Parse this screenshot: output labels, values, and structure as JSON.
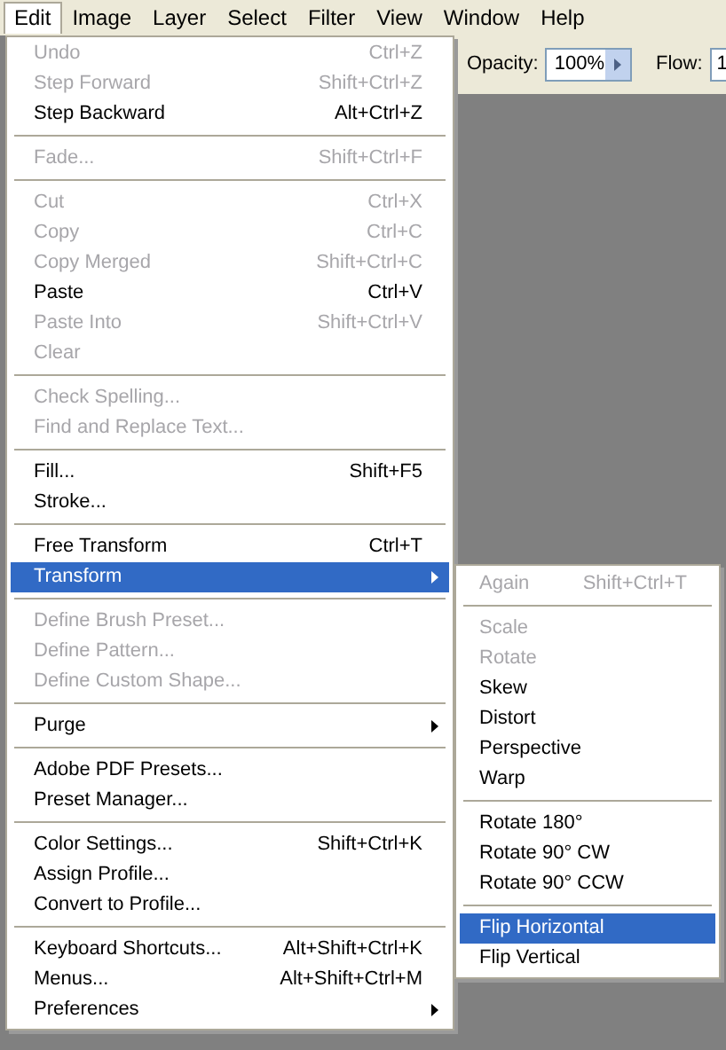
{
  "menu_bar": [
    {
      "label": "Edit",
      "selected": true
    },
    {
      "label": "Image",
      "selected": false
    },
    {
      "label": "Layer",
      "selected": false
    },
    {
      "label": "Select",
      "selected": false
    },
    {
      "label": "Filter",
      "selected": false
    },
    {
      "label": "View",
      "selected": false
    },
    {
      "label": "Window",
      "selected": false
    },
    {
      "label": "Help",
      "selected": false
    }
  ],
  "options_bar": {
    "opacity_label": "Opacity:",
    "opacity_value": "100%",
    "flow_label": "Flow:",
    "flow_value": "1"
  },
  "edit_menu": [
    [
      {
        "label": "Undo",
        "shortcut": "Ctrl+Z",
        "disabled": true,
        "selected": false,
        "submenu": false
      },
      {
        "label": "Step Forward",
        "shortcut": "Shift+Ctrl+Z",
        "disabled": true,
        "selected": false,
        "submenu": false
      },
      {
        "label": "Step Backward",
        "shortcut": "Alt+Ctrl+Z",
        "disabled": false,
        "selected": false,
        "submenu": false
      }
    ],
    [
      {
        "label": "Fade...",
        "shortcut": "Shift+Ctrl+F",
        "disabled": true,
        "selected": false,
        "submenu": false
      }
    ],
    [
      {
        "label": "Cut",
        "shortcut": "Ctrl+X",
        "disabled": true,
        "selected": false,
        "submenu": false
      },
      {
        "label": "Copy",
        "shortcut": "Ctrl+C",
        "disabled": true,
        "selected": false,
        "submenu": false
      },
      {
        "label": "Copy Merged",
        "shortcut": "Shift+Ctrl+C",
        "disabled": true,
        "selected": false,
        "submenu": false
      },
      {
        "label": "Paste",
        "shortcut": "Ctrl+V",
        "disabled": false,
        "selected": false,
        "submenu": false
      },
      {
        "label": "Paste Into",
        "shortcut": "Shift+Ctrl+V",
        "disabled": true,
        "selected": false,
        "submenu": false
      },
      {
        "label": "Clear",
        "disabled": true,
        "selected": false,
        "submenu": false
      }
    ],
    [
      {
        "label": "Check Spelling...",
        "disabled": true,
        "selected": false,
        "submenu": false
      },
      {
        "label": "Find and Replace Text...",
        "disabled": true,
        "selected": false,
        "submenu": false
      }
    ],
    [
      {
        "label": "Fill...",
        "shortcut": "Shift+F5",
        "disabled": false,
        "selected": false,
        "submenu": false
      },
      {
        "label": "Stroke...",
        "disabled": false,
        "selected": false,
        "submenu": false
      }
    ],
    [
      {
        "label": "Free Transform",
        "shortcut": "Ctrl+T",
        "disabled": false,
        "selected": false,
        "submenu": false
      },
      {
        "label": "Transform",
        "disabled": false,
        "selected": true,
        "submenu": true
      }
    ],
    [
      {
        "label": "Define Brush Preset...",
        "disabled": true,
        "selected": false,
        "submenu": false
      },
      {
        "label": "Define Pattern...",
        "disabled": true,
        "selected": false,
        "submenu": false
      },
      {
        "label": "Define Custom Shape...",
        "disabled": true,
        "selected": false,
        "submenu": false
      }
    ],
    [
      {
        "label": "Purge",
        "disabled": false,
        "selected": false,
        "submenu": true
      }
    ],
    [
      {
        "label": "Adobe PDF Presets...",
        "disabled": false,
        "selected": false,
        "submenu": false
      },
      {
        "label": "Preset Manager...",
        "disabled": false,
        "selected": false,
        "submenu": false
      }
    ],
    [
      {
        "label": "Color Settings...",
        "shortcut": "Shift+Ctrl+K",
        "disabled": false,
        "selected": false,
        "submenu": false
      },
      {
        "label": "Assign Profile...",
        "disabled": false,
        "selected": false,
        "submenu": false
      },
      {
        "label": "Convert to Profile...",
        "disabled": false,
        "selected": false,
        "submenu": false
      }
    ],
    [
      {
        "label": "Keyboard Shortcuts...",
        "shortcut": "Alt+Shift+Ctrl+K",
        "disabled": false,
        "selected": false,
        "submenu": false
      },
      {
        "label": "Menus...",
        "shortcut": "Alt+Shift+Ctrl+M",
        "disabled": false,
        "selected": false,
        "submenu": false
      },
      {
        "label": "Preferences",
        "disabled": false,
        "selected": false,
        "submenu": true
      }
    ]
  ],
  "transform_submenu": [
    [
      {
        "label": "Again",
        "shortcut": "Shift+Ctrl+T",
        "disabled": true,
        "selected": false
      }
    ],
    [
      {
        "label": "Scale",
        "disabled": true,
        "selected": false
      },
      {
        "label": "Rotate",
        "disabled": true,
        "selected": false
      },
      {
        "label": "Skew",
        "disabled": false,
        "selected": false
      },
      {
        "label": "Distort",
        "disabled": false,
        "selected": false
      },
      {
        "label": "Perspective",
        "disabled": false,
        "selected": false
      },
      {
        "label": "Warp",
        "disabled": false,
        "selected": false
      }
    ],
    [
      {
        "label": "Rotate 180°",
        "disabled": false,
        "selected": false
      },
      {
        "label": "Rotate 90° CW",
        "disabled": false,
        "selected": false
      },
      {
        "label": "Rotate 90° CCW",
        "disabled": false,
        "selected": false
      }
    ],
    [
      {
        "label": "Flip Horizontal",
        "disabled": false,
        "selected": true
      },
      {
        "label": "Flip Vertical",
        "disabled": false,
        "selected": false
      }
    ]
  ]
}
